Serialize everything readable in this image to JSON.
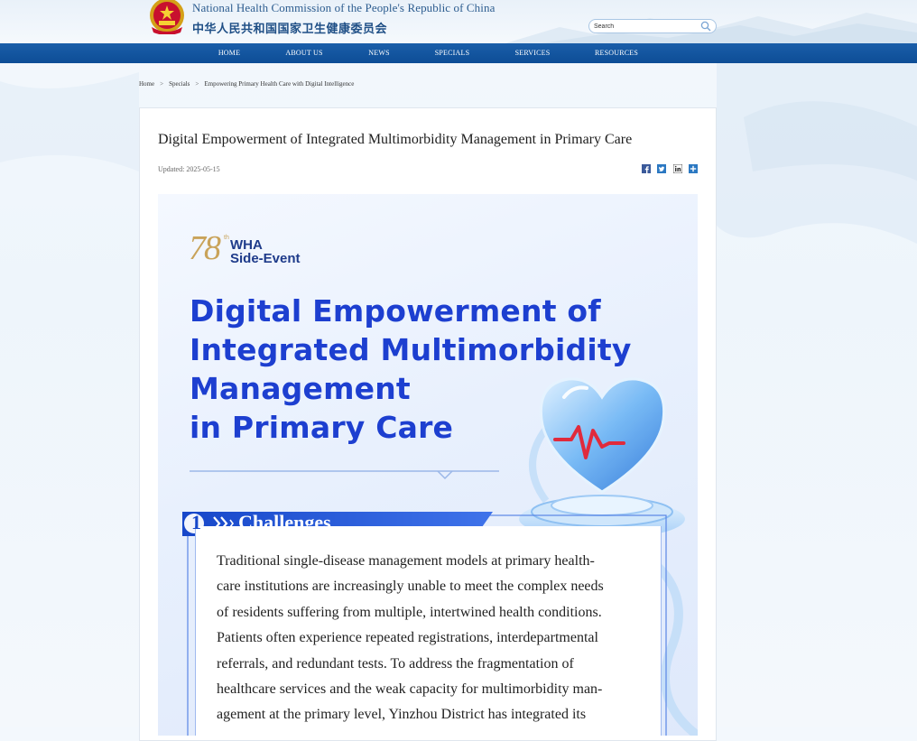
{
  "header": {
    "site_name_en": "National Health Commission of the People's Republic of China",
    "site_name_cn": "中华人民共和国国家卫生健康委员会",
    "search_value": "Search"
  },
  "nav": {
    "items": [
      {
        "label": "HOME"
      },
      {
        "label": "ABOUT US"
      },
      {
        "label": "NEWS"
      },
      {
        "label": "SPECIALS"
      },
      {
        "label": "SERVICES"
      },
      {
        "label": "RESOURCES"
      }
    ]
  },
  "breadcrumb": {
    "items": [
      "Home",
      "Specials",
      "Empowering Primary Health Care with Digital Intelligence"
    ],
    "separator": ">"
  },
  "article": {
    "title": "Digital Empowerment of Integrated Multimorbidity Management in Primary Care",
    "updated": "Updated: 2025-05-15",
    "share_icons": [
      "facebook-icon",
      "twitter-icon",
      "linkedin-icon",
      "more-share-icon"
    ]
  },
  "poster": {
    "event_number": "78",
    "event_suffix": "th",
    "event_line1": "WHA",
    "event_line2": "Side-Event",
    "title_lines": [
      "Digital Empowerment of",
      "Integrated Multimorbidity",
      "Management",
      "in Primary Care"
    ],
    "section_number": "1",
    "section_title": "Challenges",
    "body_lines": [
      "Traditional single-disease management models at primary health-",
      "care institutions are increasingly unable to meet the complex needs",
      "of residents suffering from multiple, intertwined health conditions.",
      "Patients often experience repeated registrations, interdepartmental",
      "referrals, and redundant tests. To address the fragmentation of",
      "healthcare services and the weak capacity for multimorbidity man-",
      "agement at the primary level, Yinzhou District has integrated its"
    ]
  },
  "colors": {
    "nav_bg": "#0d4d96",
    "poster_title": "#1d3fd0",
    "accent_gold": "#c9a35a",
    "heart_red": "#e02a3c"
  }
}
